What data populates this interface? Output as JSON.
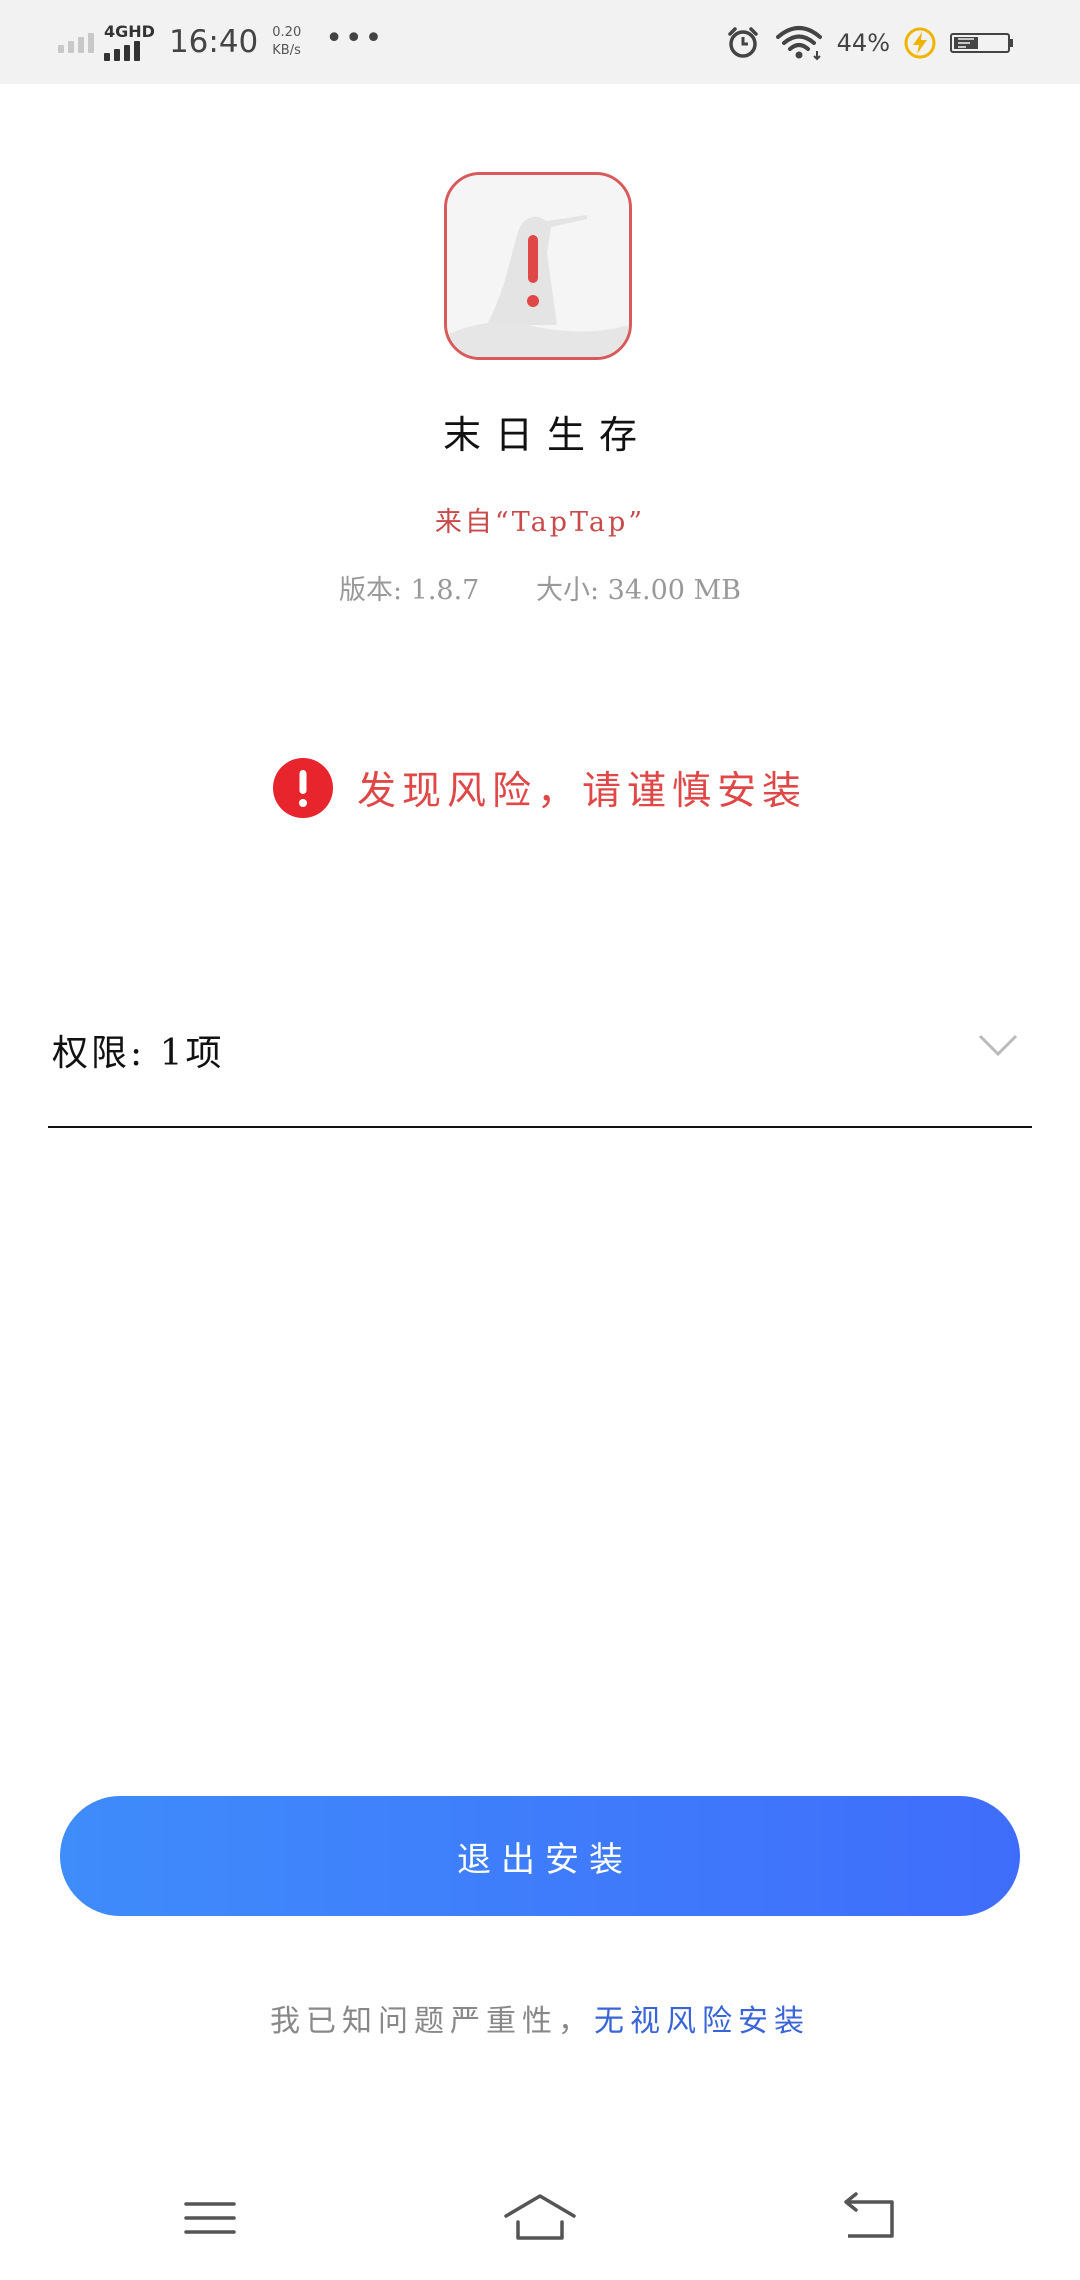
{
  "status_bar": {
    "network": "4GHD",
    "time": "16:40",
    "speed_value": "0.20",
    "speed_unit": "KB/s",
    "more": "•••",
    "battery": "44%"
  },
  "app": {
    "name": "末日生存",
    "source": "来自“TapTap”",
    "version": "版本: 1.8.7",
    "size": "大小: 34.00 MB"
  },
  "risk": {
    "message": "发现风险，请谨慎安装"
  },
  "permissions": {
    "label": "权限: 1项"
  },
  "actions": {
    "exit_label": "退出安装",
    "ignore_prefix": "我已知问题严重性，",
    "ignore_link": "无视风险安装"
  },
  "colors": {
    "warning_red": "#e04848",
    "button_blue": "#3f7cfb",
    "link_blue": "#3a65d8"
  }
}
